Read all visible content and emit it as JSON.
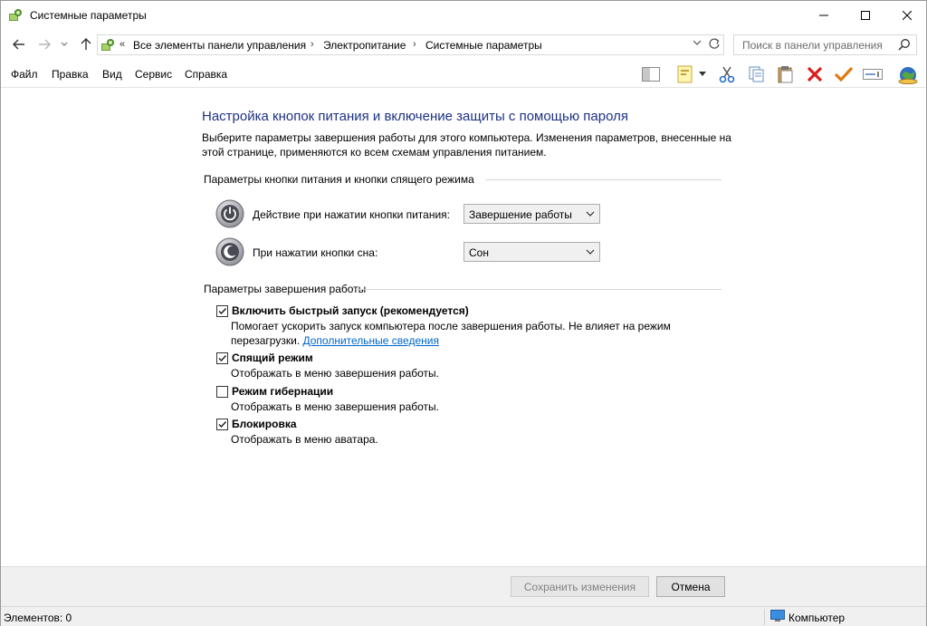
{
  "window": {
    "title": "Системные параметры"
  },
  "address": {
    "overflow": "«",
    "crumbs": [
      "Все элементы панели управления",
      "Электропитание",
      "Системные параметры"
    ],
    "separator": "›",
    "search_placeholder": "Поиск в панели управления"
  },
  "menu": {
    "items": [
      "Файл",
      "Правка",
      "Вид",
      "Сервис",
      "Справка"
    ]
  },
  "page": {
    "heading": "Настройка кнопок питания и включение защиты с помощью пароля",
    "description": "Выберите параметры завершения работы для этого компьютера. Изменения параметров, внесенные на этой странице, применяются ко всем схемам управления питанием.",
    "group1_title": "Параметры кнопки питания и кнопки спящего режима",
    "power_button_label": "Действие при нажатии кнопки питания:",
    "power_button_value": "Завершение работы",
    "sleep_button_label": "При нажатии кнопки сна:",
    "sleep_button_value": "Сон",
    "group2_title": "Параметры завершения работы",
    "options": [
      {
        "label": "Включить быстрый запуск (рекомендуется)",
        "checked": true,
        "note1": "Помогает ускорить запуск компьютера после завершения работы. Не влияет на режим",
        "note2": "перезагрузки.",
        "link": "Дополнительные сведения"
      },
      {
        "label": "Спящий режим",
        "checked": true,
        "note1": "Отображать в меню завершения работы."
      },
      {
        "label": "Режим гибернации",
        "checked": false,
        "note1": "Отображать в меню завершения работы."
      },
      {
        "label": "Блокировка",
        "checked": true,
        "note1": "Отображать в меню аватара."
      }
    ]
  },
  "buttons": {
    "save": "Сохранить изменения",
    "cancel": "Отмена"
  },
  "status": {
    "items": "Элементов: 0",
    "location": "Компьютер"
  },
  "colors": {
    "heading": "#1e3287",
    "link": "#0066cc",
    "delete_icon": "#d81e1e",
    "check_icon": "#e07a10"
  }
}
